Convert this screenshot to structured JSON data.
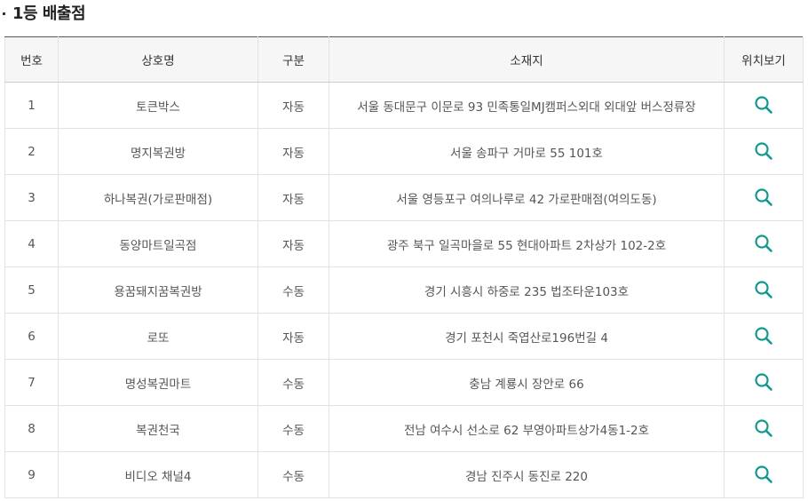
{
  "section": {
    "title": "1등 배출점"
  },
  "table": {
    "headers": {
      "no": "번호",
      "name": "상호명",
      "type": "구분",
      "address": "소재지",
      "location": "위치보기"
    },
    "rows": [
      {
        "no": "1",
        "name": "토큰박스",
        "type": "자동",
        "address": "서울 동대문구 이문로 93 민족통일MJ캠퍼스외대 외대앞 버스정류장"
      },
      {
        "no": "2",
        "name": "명지복권방",
        "type": "자동",
        "address": "서울 송파구 거마로 55 101호"
      },
      {
        "no": "3",
        "name": "하나복권(가로판매점)",
        "type": "자동",
        "address": "서울 영등포구 여의나루로 42 가로판매점(여의도동)"
      },
      {
        "no": "4",
        "name": "동양마트일곡점",
        "type": "자동",
        "address": "광주 북구 일곡마을로 55 현대아파트 2차상가 102-2호"
      },
      {
        "no": "5",
        "name": "용꿈돼지꿈복권방",
        "type": "수동",
        "address": "경기 시흥시 하중로 235 법조타운103호"
      },
      {
        "no": "6",
        "name": "로또",
        "type": "자동",
        "address": "경기 포천시 죽엽산로196번길 4"
      },
      {
        "no": "7",
        "name": "명성복권마트",
        "type": "수동",
        "address": "충남 계룡시 장안로 66"
      },
      {
        "no": "8",
        "name": "복권천국",
        "type": "수동",
        "address": "전남 여수시 선소로 62 부영아파트상가4동1-2호"
      },
      {
        "no": "9",
        "name": "비디오 채널4",
        "type": "수동",
        "address": "경남 진주시 동진로 220"
      }
    ]
  },
  "icons": {
    "location_action": "search-icon"
  },
  "colors": {
    "icon": "#12998e",
    "header_bg": "#f6f6f6",
    "header_top_border": "#555555",
    "cell_border": "#e3e3e3"
  }
}
